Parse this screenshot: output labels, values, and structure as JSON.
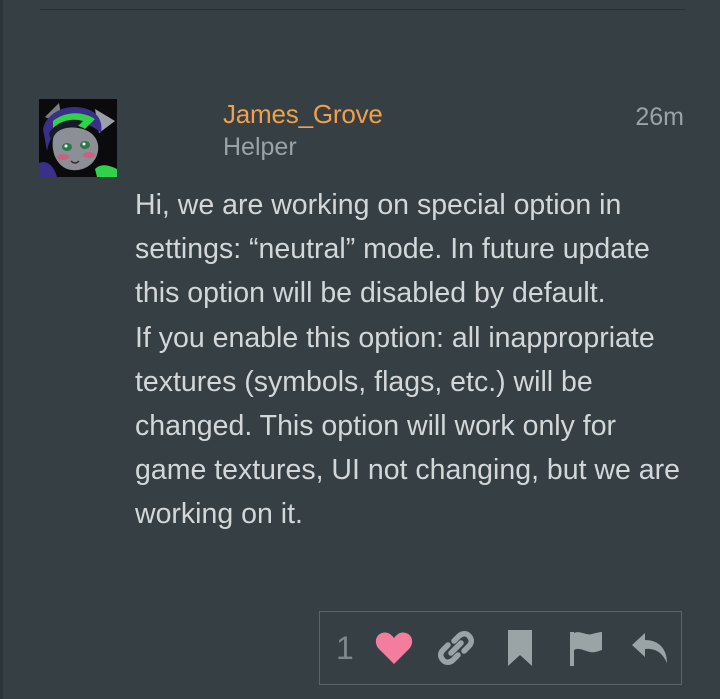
{
  "post": {
    "author": {
      "name": "James_Grove",
      "title": "Helper",
      "name_color": "#f0a04b"
    },
    "timestamp": "26m",
    "body": {
      "paragraph_1": "Hi, we are working on special option in settings: “neutral” mode. In future update this option will be disabled by default.",
      "paragraph_2": "If you enable this option: all inappropriate textures (symbols, flags, etc.) will be changed. This option will work only for game textures, UI not changing, but we are working on it."
    },
    "actions": {
      "like_count": "1",
      "like_color": "#f47c9c",
      "icons": [
        "heart-icon",
        "link-icon",
        "bookmark-icon",
        "flag-icon",
        "reply-icon"
      ]
    }
  },
  "colors": {
    "background": "#353f44",
    "text": "#d3d7d8",
    "muted": "#9aa3a6",
    "icon": "#9aa3a6"
  }
}
